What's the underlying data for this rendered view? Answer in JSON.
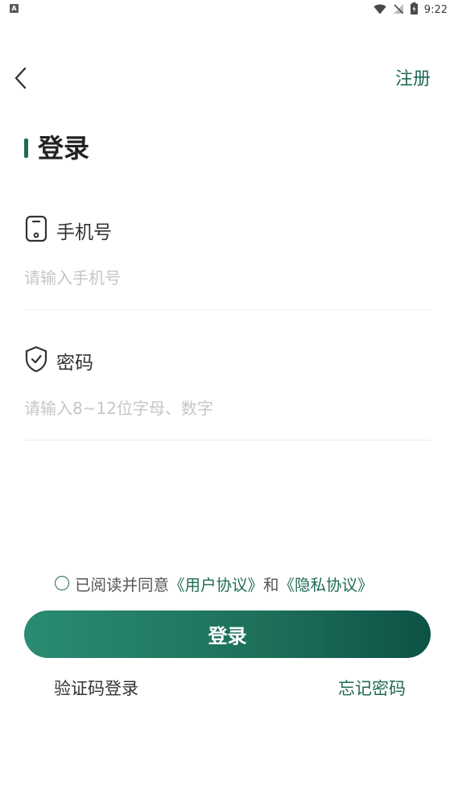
{
  "status_bar": {
    "left_icon_letter": "A",
    "time": "9:22",
    "icons": [
      "wifi-icon",
      "no-signal-icon",
      "battery-icon"
    ]
  },
  "header": {
    "back_icon": "chevron-left-icon",
    "register_label": "注册"
  },
  "title": "登录",
  "phone_field": {
    "icon": "phone-icon",
    "label": "手机号",
    "value": "",
    "placeholder": "请输入手机号"
  },
  "password_field": {
    "icon": "shield-check-icon",
    "label": "密码",
    "value": "",
    "placeholder": "请输入8~12位字母、数字"
  },
  "agreement": {
    "prefix": "已阅读并同意",
    "user_agreement": "《用户协议》",
    "conjunction": "和",
    "privacy_policy": "《隐私协议》"
  },
  "login_button_label": "登录",
  "footer": {
    "sms_login_label": "验证码登录",
    "forgot_password_label": "忘记密码"
  },
  "colors": {
    "accent": "#1f6b57",
    "button_gradient_start": "#2a8c72",
    "button_gradient_end": "#0d5246",
    "placeholder": "#c6c6c6"
  }
}
